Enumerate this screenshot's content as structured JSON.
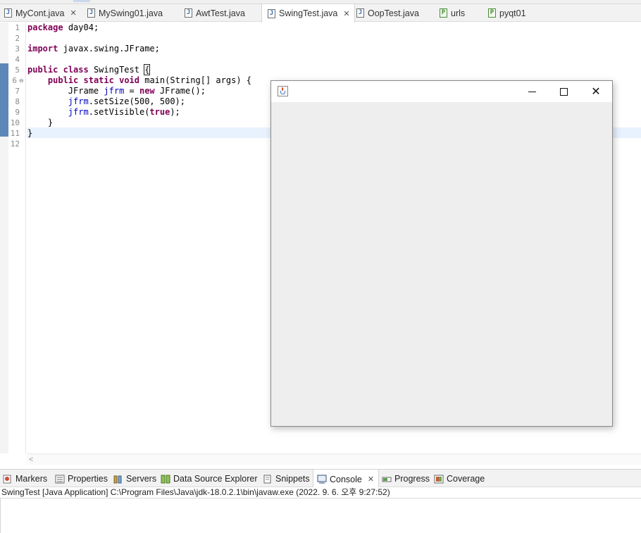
{
  "editor_tabs": [
    {
      "label": "MyCont.java",
      "icon": "java-file-icon",
      "closable": true,
      "active": false
    },
    {
      "label": "MySwing01.java",
      "icon": "java-file-icon",
      "closable": false,
      "active": false
    },
    {
      "label": "AwtTest.java",
      "icon": "java-file-icon",
      "closable": false,
      "active": false
    },
    {
      "label": "SwingTest.java",
      "icon": "java-file-icon",
      "closable": true,
      "active": true
    },
    {
      "label": "OopTest.java",
      "icon": "java-file-icon",
      "closable": false,
      "active": false
    },
    {
      "label": "urls",
      "icon": "python-file-icon",
      "closable": false,
      "active": false
    },
    {
      "label": "pyqt01",
      "icon": "python-file-icon",
      "closable": false,
      "active": false
    }
  ],
  "close_glyph": "✕",
  "fold_glyph": "⊖",
  "code_lines": [
    {
      "n": "1",
      "text": "package day04;"
    },
    {
      "n": "2",
      "text": ""
    },
    {
      "n": "3",
      "text": "import javax.swing.JFrame;"
    },
    {
      "n": "4",
      "text": ""
    },
    {
      "n": "5",
      "text": "public class SwingTest {"
    },
    {
      "n": "6",
      "text": "    public static void main(String[] args) {"
    },
    {
      "n": "7",
      "text": "        JFrame jfrm = new JFrame();"
    },
    {
      "n": "8",
      "text": "        jfrm.setSize(500, 500);"
    },
    {
      "n": "9",
      "text": "        jfrm.setVisible(true);"
    },
    {
      "n": "10",
      "text": "    }"
    },
    {
      "n": "11",
      "text": "}"
    },
    {
      "n": "12",
      "text": ""
    }
  ],
  "scroll_left_glyph": "<",
  "panel_tabs": [
    {
      "label": "Markers",
      "icon": "markers-icon",
      "active": false
    },
    {
      "label": "Properties",
      "icon": "properties-icon",
      "active": false
    },
    {
      "label": "Servers",
      "icon": "servers-icon",
      "active": false
    },
    {
      "label": "Data Source Explorer",
      "icon": "data-source-icon",
      "active": false
    },
    {
      "label": "Snippets",
      "icon": "snippets-icon",
      "active": false
    },
    {
      "label": "Console",
      "icon": "console-icon",
      "active": true
    },
    {
      "label": "Progress",
      "icon": "progress-icon",
      "active": false
    },
    {
      "label": "Coverage",
      "icon": "coverage-icon",
      "active": false
    }
  ],
  "console": {
    "header": "SwingTest [Java Application] C:\\Program Files\\Java\\jdk-18.0.2.1\\bin\\javaw.exe  (2022. 9. 6. 오후 9:27:52)"
  },
  "jframe": {
    "title": "",
    "icon": "java-coffee-cup-icon",
    "close_glyph": "✕"
  },
  "colors": {
    "keyword": "#7f0055",
    "variable": "#0000c0",
    "current_line": "#e8f2fe",
    "ruler": "#5d87b8",
    "jframe_background": "#eeeeee"
  }
}
